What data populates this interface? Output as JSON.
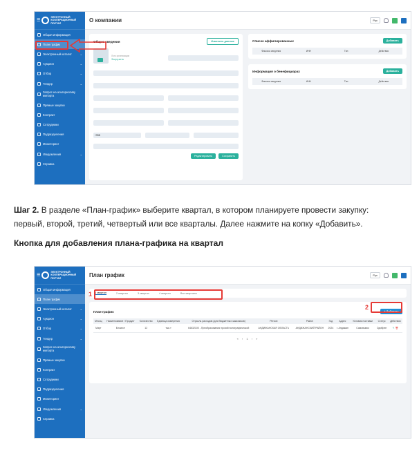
{
  "sidebar": {
    "logo": "ЭЛЕКТРОННЫЙ КООПЕРАЦИОННЫЙ ПОРТАЛ",
    "items": [
      {
        "label": "Общая информация"
      },
      {
        "label": "План график"
      },
      {
        "label": "Электронный каталог"
      },
      {
        "label": "Аукцион"
      },
      {
        "label": "Отбор"
      },
      {
        "label": "Тендер"
      },
      {
        "label": "Запрос на альтернативу импорта"
      },
      {
        "label": "Прямые закупки"
      },
      {
        "label": "Контракт"
      },
      {
        "label": "Сотрудники"
      },
      {
        "label": "Подразделения"
      },
      {
        "label": "Мониторинг"
      },
      {
        "label": "Уведомления"
      },
      {
        "label": "Справка"
      }
    ]
  },
  "topbar": {
    "lang": "Рус"
  },
  "shot1": {
    "title": "О компании",
    "general": {
      "heading": "Общие сведения",
      "change_data": "Изменить данные",
      "logo_label": "Лого организации",
      "load_link": "Загрузить",
      "phone_prefix": "+998"
    },
    "buttons": {
      "edit": "Редактировать",
      "save": "Сохранить"
    },
    "affiliates": {
      "heading": "Список аффилированных",
      "add": "Добавить",
      "cols": [
        "Фиксиса сведения",
        "ИНН",
        "Тип",
        "Действия"
      ]
    },
    "beneficiaries": {
      "heading": "Информация о бенефициарах",
      "add": "Добавить",
      "cols": [
        "Фиксиса сведения",
        "ИНН",
        "Тип",
        "Действия"
      ]
    }
  },
  "instruction": {
    "line1_bold": "Шаг 2.",
    "line1": " В разделе «План-график» выберите квартал, в котором планируете провести закупку:",
    "line2": "первый, второй, третий, четвертый или все кварталы. Далее нажмите на копку «Добавить».",
    "heading": "Кнопка для добавления плана-графика на квартал"
  },
  "shot2": {
    "title": "План график",
    "tabs": [
      "1 квартал",
      "2 квартал",
      "3 квартал",
      "4 квартал",
      "Все кварталы"
    ],
    "section": "План-график",
    "add": "Добавить",
    "marker1": "1",
    "marker2": "2",
    "table": {
      "headers": [
        "Месяц",
        "Наименование / Продукт",
        "Количество",
        "Единица измерения",
        "Отрасль расходов (для бюджетных заказчиков)",
        "Регион",
        "Район",
        "Год",
        "Адрес",
        "Условия поставки",
        "Статус",
        "Действия"
      ],
      "row": [
        "Март",
        "Блокнот",
        "12",
        "тыс.т",
        "64632100 - Преобразования прочий полиграфической",
        "АНДИЖАНСКАЯ ОБЛАСТЬ",
        "АНДИЖАНСКИЙ РАЙОН",
        "2024",
        "г. Андижан",
        "Самовывоз",
        "Одобрен"
      ]
    },
    "pager": "«  ‹  1  ›  »"
  }
}
